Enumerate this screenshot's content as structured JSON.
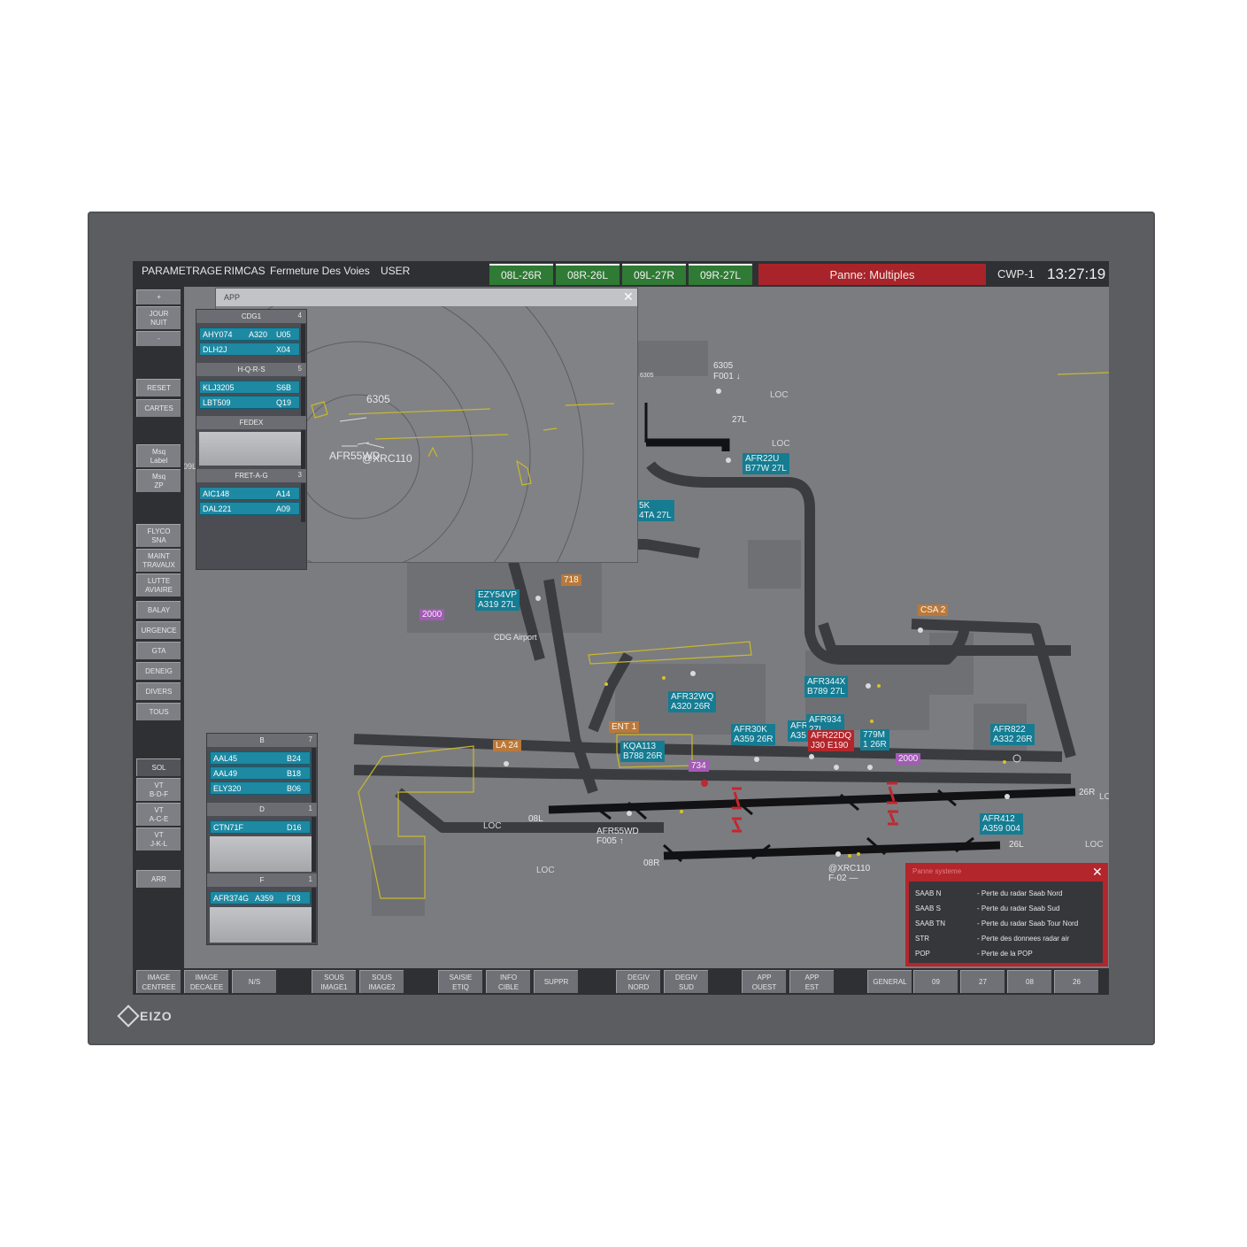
{
  "brand": "EIZO",
  "menu": [
    "PARAMETRAGE",
    "RIMCAS",
    "Fermeture Des Voies",
    "USER"
  ],
  "runway_tabs": [
    "08L-26R",
    "08R-26L",
    "09L-27R",
    "09R-27L"
  ],
  "alarm": "Panne: Multiples",
  "workstation": "CWP-1",
  "clock": "13:27:19",
  "colors": {
    "alarm_red": "#a8242a",
    "runway_green": "#2f7a34",
    "label_teal": "#157c92",
    "strip_teal": "#1d89a3"
  },
  "left_toolbar": {
    "plus": "+",
    "jour": "JOUR",
    "nuit": "NUIT",
    "minus": "-",
    "reset": "RESET",
    "cartes": "CARTES",
    "msq_label_1": "Msq",
    "msq_label_2": "Label",
    "msq_zp_1": "Msq",
    "msq_zp_2": "ZP",
    "flyco_1": "FLYCO",
    "flyco_2": "SNA",
    "maint_1": "MAINT",
    "maint_2": "TRAVAUX",
    "lutte_1": "LUTTE",
    "lutte_2": "AVIAIRE",
    "balay": "BALAY",
    "urgence": "URGENCE",
    "gta": "GTA",
    "deneig": "DENEIG",
    "divers": "DIVERS",
    "tous": "TOUS",
    "sol": "SOL",
    "vt_bdf_1": "VT",
    "vt_bdf_2": "B-D-F",
    "vt_ace_1": "VT",
    "vt_ace_2": "A-C-E",
    "vt_jkl_1": "VT",
    "vt_jkl_2": "J-K-L",
    "arr": "ARR"
  },
  "bottom_toolbar": {
    "image_centree_1": "IMAGE",
    "image_centree_2": "CENTREE",
    "image_decalee_1": "IMAGE",
    "image_decalee_2": "DECALEE",
    "ns": "N/S",
    "sous_image1_1": "SOUS",
    "sous_image1_2": "IMAGE1",
    "sous_image2_1": "SOUS",
    "sous_image2_2": "IMAGE2",
    "saisie_1": "SAISIE",
    "saisie_2": "ETIQ",
    "info_1": "INFO",
    "info_2": "CIBLE",
    "suppr": "SUPPR",
    "degiv_nord_1": "DEGIV",
    "degiv_nord_2": "NORD",
    "degiv_sud_1": "DEGIV",
    "degiv_sud_2": "SUD",
    "app_ouest_1": "APP",
    "app_ouest_2": "OUEST",
    "app_est_1": "APP",
    "app_est_2": "EST",
    "general": "GENERAL",
    "r09": "09",
    "r27": "27",
    "r08": "08",
    "r26": "26"
  },
  "app_window": {
    "title": "APP",
    "close": "✕",
    "radar_label": "6305",
    "tracks": "AFR55WD",
    "track2": "@XRC110",
    "side_label": "09L"
  },
  "strip_bays_top": [
    {
      "name": "CDG1",
      "count": "4",
      "strips": [
        [
          "AHY074",
          "A320",
          "U05"
        ],
        [
          "DLH2J",
          "",
          "X04"
        ]
      ]
    },
    {
      "name": "H-Q-R-S",
      "count": "5",
      "strips": [
        [
          "KLJ3205",
          "",
          "S6B"
        ],
        [
          "LBT509",
          "",
          "Q19"
        ]
      ]
    },
    {
      "name": "FEDEX",
      "count": "",
      "strips": []
    },
    {
      "name": "FRET-A-G",
      "count": "3",
      "strips": [
        [
          "AIC148",
          "",
          "A14"
        ],
        [
          "DAL221",
          "",
          "A09"
        ]
      ]
    }
  ],
  "strip_bays_bottom": [
    {
      "name": "B",
      "count": "7",
      "strips": [
        [
          "AAL45",
          "",
          "B24"
        ],
        [
          "AAL49",
          "",
          "B18"
        ],
        [
          "ELY320",
          "",
          "B06"
        ]
      ]
    },
    {
      "name": "D",
      "count": "1",
      "strips": [
        [
          "CTN71F",
          "",
          "D16"
        ]
      ]
    },
    {
      "name": "F",
      "count": "1",
      "strips": [
        [
          "AFR374G",
          "A359",
          "F03"
        ]
      ]
    }
  ],
  "map": {
    "airport_name": "CDG Airport",
    "runway_labels": {
      "r27l": "27L",
      "r08l": "08L",
      "r08r": "08R",
      "r26r": "26R",
      "r26l": "26L"
    },
    "loc": "LOC",
    "sq_6305_1": "6305",
    "sq_6305_2": "F001 ↓",
    "sq_6305_small": "6305",
    "afr55wd_1": "AFR55WD",
    "afr55wd_2": "F005 ↑",
    "xrc110_1": "@XRC110",
    "xrc110_2": "F-02 —",
    "labels_teal": [
      {
        "l1": "AFR22U",
        "l2": "B77W 27L"
      },
      {
        "l1": "EZY54VP",
        "l2": "A319 27L"
      },
      {
        "l1": "AFR344X",
        "l2": "B789 27L"
      },
      {
        "l1": "AFR32WQ",
        "l2": "A320 26R"
      },
      {
        "l1": "AFR30K",
        "l2": "A359 26R"
      },
      {
        "l1": "AFR768",
        "l2": "A35"
      },
      {
        "l1": "AFR934",
        "l2": "27L"
      },
      {
        "l1": "779M",
        "l2": "1 26R"
      },
      {
        "l1": "KQA113",
        "l2": "B788 26R"
      },
      {
        "l1": "AFR822",
        "l2": "A332 26R"
      },
      {
        "l1": "AFR412",
        "l2": "A359 004"
      },
      {
        "l1": "5K",
        "l2": "4TA 27L"
      }
    ],
    "label_red": {
      "l1": "AFR22DQ",
      "l2": "J30   E190"
    },
    "label_orange": [
      "718",
      "CSA 2",
      "ENT 1",
      "LA 24"
    ],
    "label_purple": [
      "2000",
      "2000",
      "734"
    ]
  },
  "panne_window": {
    "title": "Panne systeme",
    "close": "✕",
    "rows": [
      {
        "code": "SAAB N",
        "desc": "- Perte du radar Saab Nord"
      },
      {
        "code": "SAAB S",
        "desc": "- Perte du radar Saab Sud"
      },
      {
        "code": "SAAB TN",
        "desc": "- Perte du radar Saab Tour Nord"
      },
      {
        "code": "STR",
        "desc": "- Perte des donnees radar air"
      },
      {
        "code": "POP",
        "desc": "- Perte de la POP"
      }
    ]
  }
}
